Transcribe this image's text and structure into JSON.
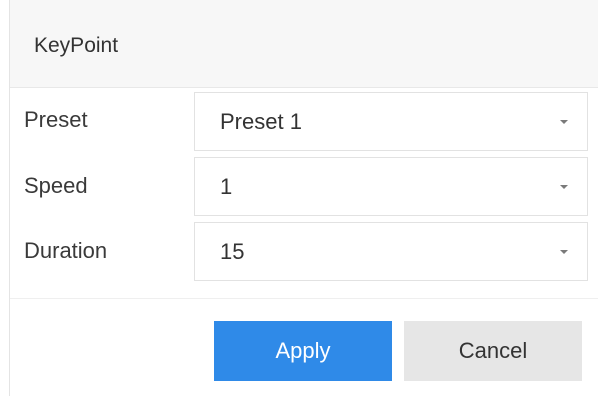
{
  "dialog": {
    "title": "KeyPoint"
  },
  "fields": [
    {
      "label": "Preset",
      "value": "Preset 1"
    },
    {
      "label": "Speed",
      "value": "1"
    },
    {
      "label": "Duration",
      "value": "15"
    }
  ],
  "buttons": {
    "apply": "Apply",
    "cancel": "Cancel"
  },
  "colors": {
    "primary": "#2f8ae8",
    "secondary": "#e6e6e6",
    "header_bg": "#f7f7f7"
  }
}
